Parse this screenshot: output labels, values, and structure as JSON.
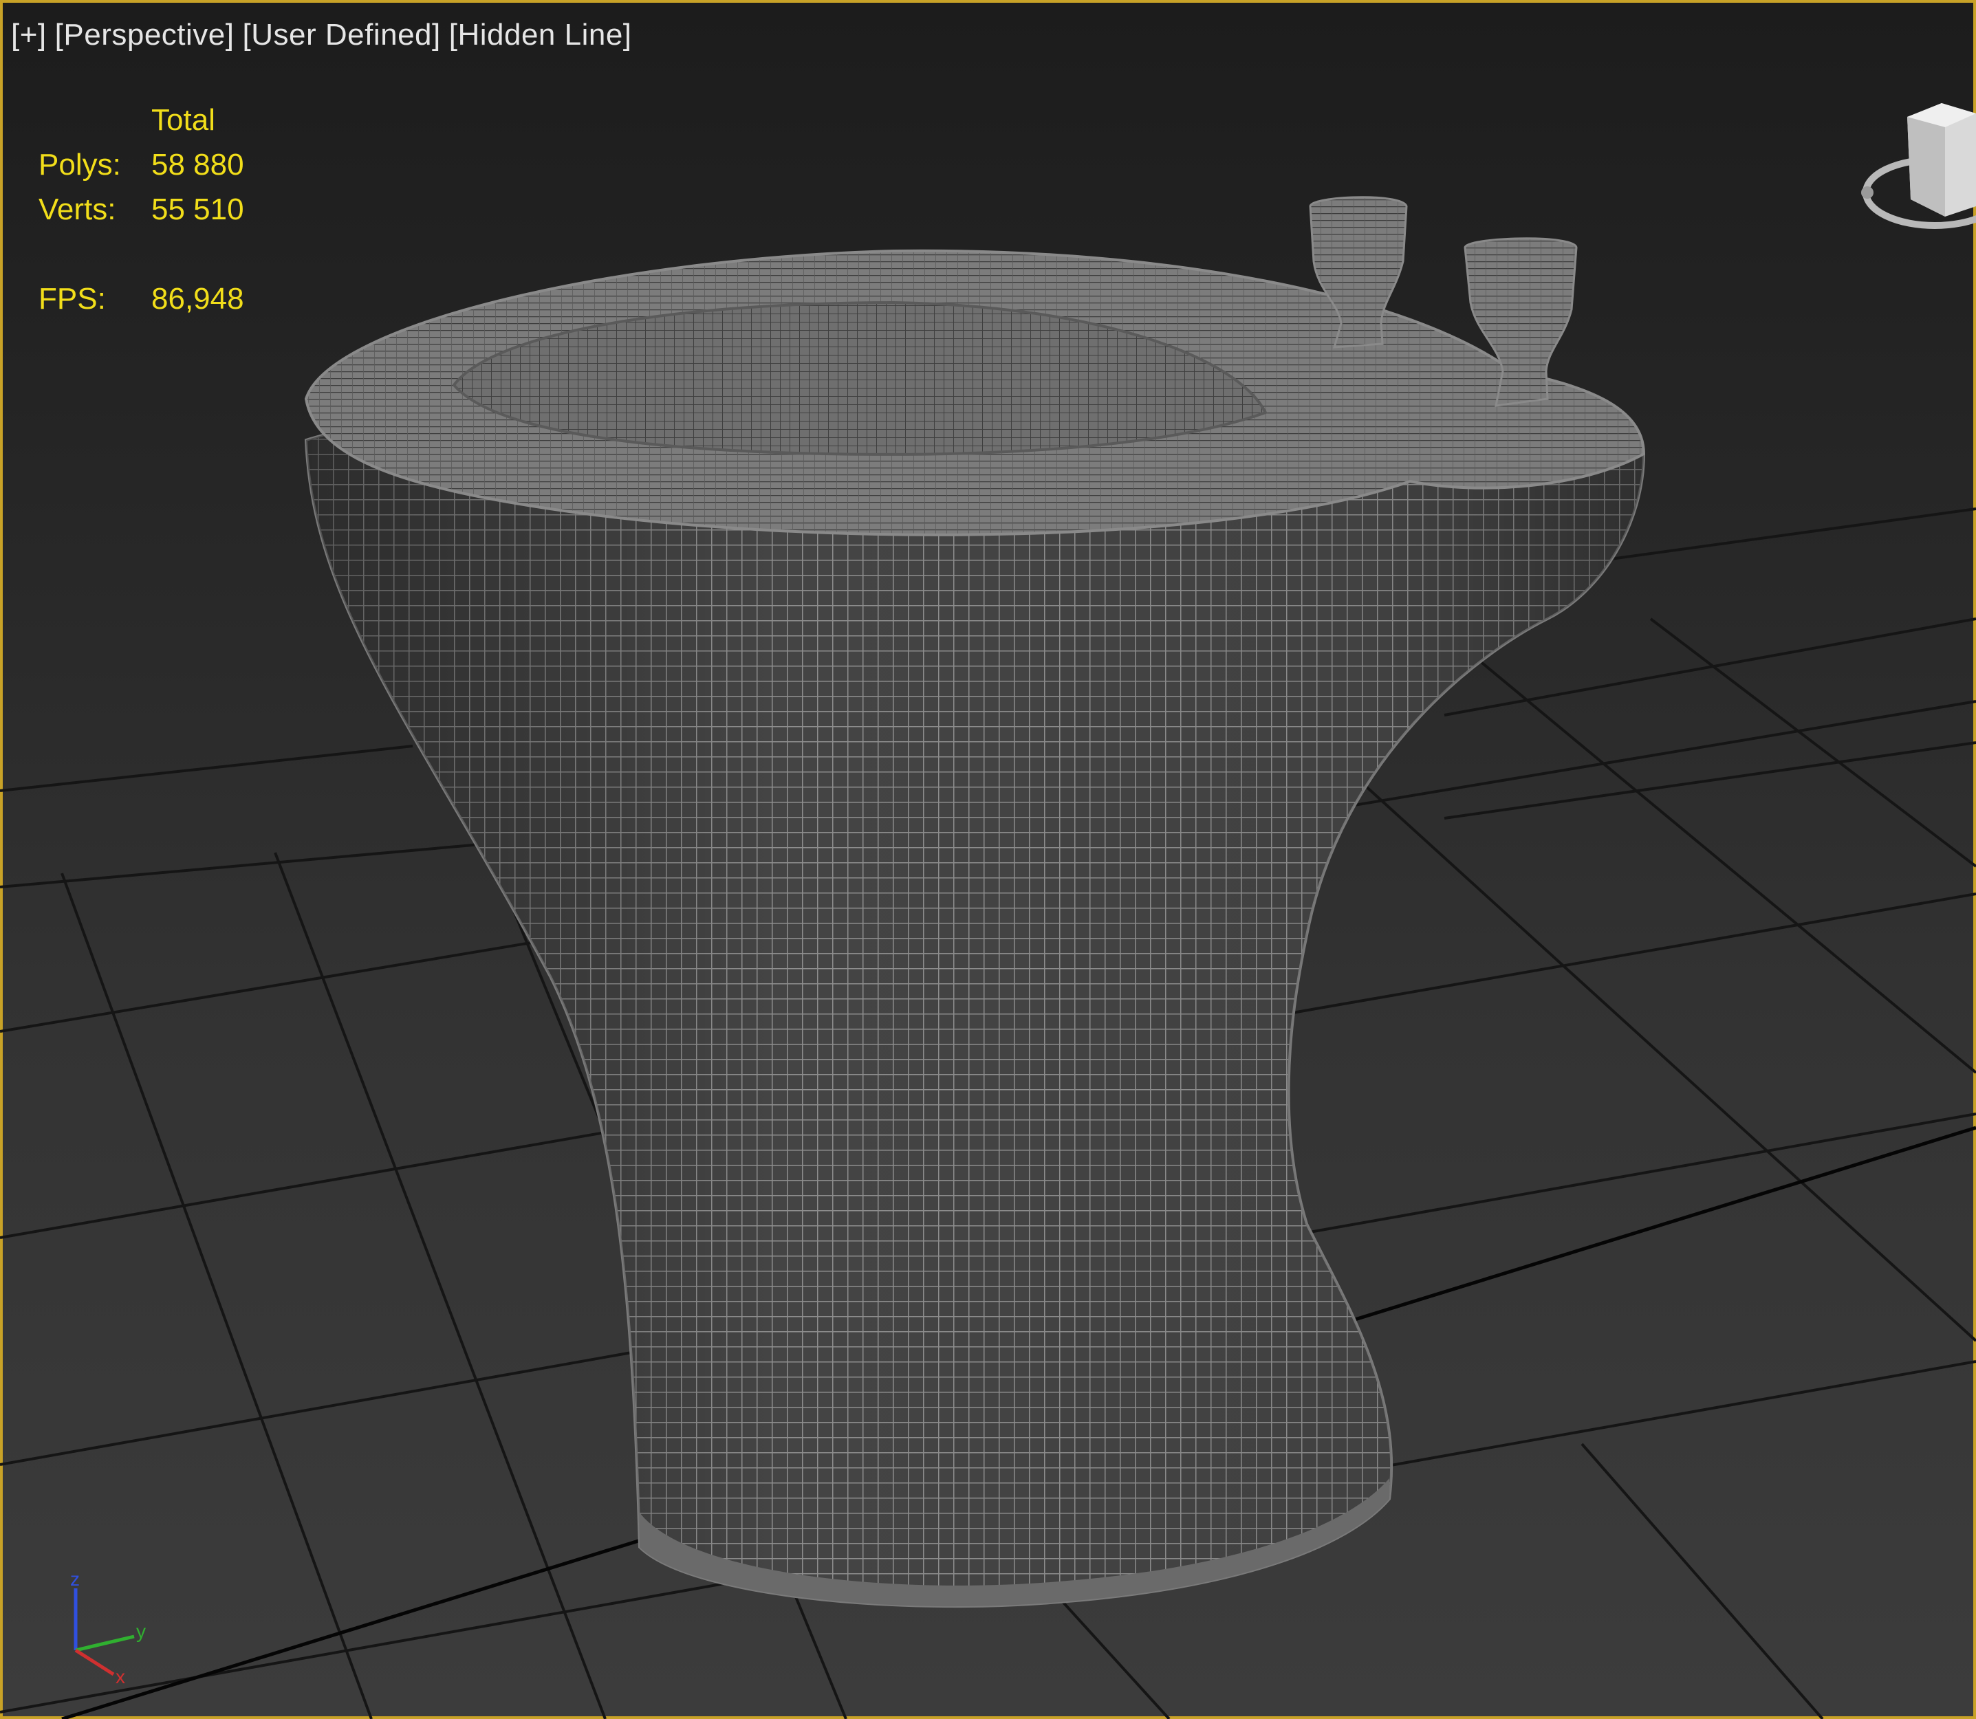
{
  "viewport_menu": {
    "plus": "[+]",
    "view": "[Perspective]",
    "camera": "[User Defined]",
    "shading": "[Hidden Line]"
  },
  "stats": {
    "header": "Total",
    "polys_label": "Polys:",
    "polys_value": "58 880",
    "verts_label": "Verts:",
    "verts_value": "55 510",
    "fps_label": "FPS:",
    "fps_value": "86,948"
  },
  "gizmo": {
    "z": "z",
    "y": "y",
    "x": "x"
  },
  "colors": {
    "viewport_border": "#c8a227",
    "stats_text": "#f2de1a",
    "menu_text": "#e6e6e6",
    "mesh_fill": "#444444",
    "mesh_wire": "#8f8f8f",
    "grid_line": "#151515",
    "axis_x": "#d03030",
    "axis_y": "#30b030",
    "axis_z": "#3050e0"
  },
  "icons": [
    "viewcube-icon",
    "axis-tripod-icon"
  ]
}
